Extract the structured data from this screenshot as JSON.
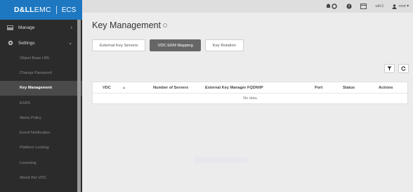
{
  "brand": {
    "logo_bold": "D&LL",
    "logo_thin": "EMC",
    "product": "ECS"
  },
  "sidebar": {
    "manage_label": "Manage",
    "settings_label": "Settings",
    "items": [
      {
        "label": "Object Base URL"
      },
      {
        "label": "Change Password"
      },
      {
        "label": "Key Management"
      },
      {
        "label": "ESRS"
      },
      {
        "label": "Alerts Policy"
      },
      {
        "label": "Event Notification"
      },
      {
        "label": "Platform Locking"
      },
      {
        "label": "Licensing"
      },
      {
        "label": "About this VDC"
      }
    ]
  },
  "topbar": {
    "vdc": "vdc1",
    "user": "root ▾"
  },
  "page": {
    "title": "Key Management"
  },
  "tabs": [
    {
      "label": "External Key Servers"
    },
    {
      "label": "VDC EKM Mapping"
    },
    {
      "label": "Key Rotation"
    }
  ],
  "table": {
    "columns": [
      "VDC",
      "Number of Servers",
      "External Key Manager FQDN/IP",
      "Port",
      "Status",
      "Actions"
    ],
    "empty_text": "No data"
  },
  "colors": {
    "brand_blue": "#1e78c1",
    "sidebar_bg": "#2b2b2b",
    "active_tab": "#666666"
  }
}
